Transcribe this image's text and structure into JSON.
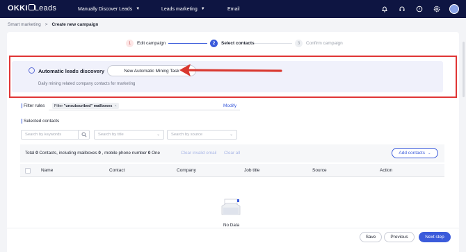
{
  "app": {
    "brand_main": "OKKI",
    "brand_sub": "Leads"
  },
  "nav": {
    "items": [
      {
        "label": "Manually Discover Leads"
      },
      {
        "label": "Leads marketing"
      },
      {
        "label": "Email"
      }
    ],
    "icons": [
      "bell-icon",
      "headset-icon",
      "help-icon",
      "settings-icon"
    ]
  },
  "breadcrumb": {
    "parent": "Smart marketing",
    "separator": ">",
    "current": "Create new campaign"
  },
  "steps": [
    {
      "num": "1",
      "label": "Edit campaign"
    },
    {
      "num": "2",
      "label": "Select contacts"
    },
    {
      "num": "3",
      "label": "Confirm campaign"
    }
  ],
  "discovery": {
    "title": "Automatic leads discovery",
    "button": "New Automatic Mining Task",
    "subtitle": "Daily mining related company contacts for marketing"
  },
  "filter": {
    "label": "Filter rules",
    "chip_prefix": "Filter",
    "chip_value": "\"unsubscribed\" mailboxes",
    "chip_close": "×",
    "modify": "Modify"
  },
  "selected": {
    "label": "Selected contacts",
    "search_placeholder": "Search by keywords",
    "title_placeholder": "Search by title",
    "source_placeholder": "Search by source"
  },
  "totals": {
    "t1": "Total ",
    "contacts": "0",
    "t2": " Contacts, including mailboxes ",
    "mailboxes": "0",
    "t3": " , mobile phone number ",
    "phones": "0",
    "t4": " One",
    "clear_invalid": "Clear invalid email",
    "clear_all": "Clear all",
    "add_contacts": "Add contacts"
  },
  "table": {
    "columns": [
      "Name",
      "Contact",
      "Company",
      "Job title",
      "Source",
      "Action"
    ],
    "empty": "No Data"
  },
  "footer": {
    "save": "Save",
    "previous": "Previous",
    "next": "Next step"
  },
  "colors": {
    "navbar": "#0e1542",
    "accent": "#3b5bdb",
    "highlight_box": "#e03535",
    "arrow": "#d9382f"
  }
}
